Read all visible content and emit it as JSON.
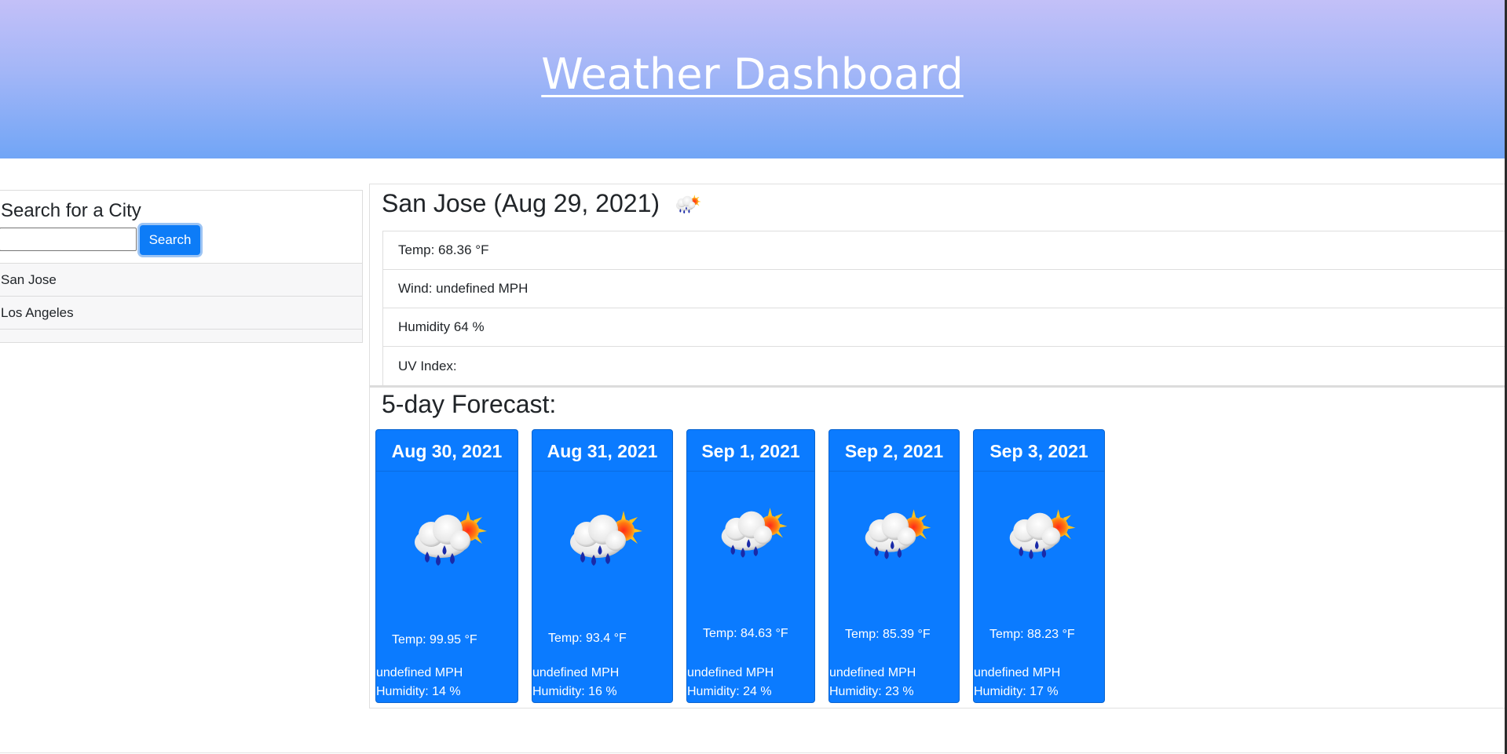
{
  "header": {
    "title": "Weather Dashboard"
  },
  "search": {
    "heading": "Search for a City",
    "input_value": "",
    "input_placeholder": "",
    "button_label": "Search",
    "history": [
      "San Jose",
      "Los Angeles"
    ]
  },
  "current": {
    "title": "San Jose (Aug 29, 2021)",
    "icon": "rain-sun-icon",
    "temp": "Temp: 68.36 °F",
    "wind": "Wind: undefined MPH",
    "humidity": "Humidity 64 %",
    "uv": "UV Index:"
  },
  "forecast": {
    "heading": "5-day Forecast:",
    "days": [
      {
        "date": "Aug 30, 2021",
        "icon": "rain-sun-icon",
        "temp": "Temp: 99.95 °F",
        "wind": "undefined MPH",
        "humidity": "Humidity: 14 %"
      },
      {
        "date": "Aug 31, 2021",
        "icon": "rain-sun-icon",
        "temp": "Temp: 93.4 °F",
        "wind": "undefined MPH",
        "humidity": "Humidity: 16 %"
      },
      {
        "date": "Sep 1, 2021",
        "icon": "rain-sun-icon",
        "temp": "Temp: 84.63 °F",
        "wind": "undefined MPH",
        "humidity": "Humidity: 24 %"
      },
      {
        "date": "Sep 2, 2021",
        "icon": "rain-sun-icon",
        "temp": "Temp: 85.39 °F",
        "wind": "undefined MPH",
        "humidity": "Humidity: 23 %"
      },
      {
        "date": "Sep 3, 2021",
        "icon": "rain-sun-icon",
        "temp": "Temp: 88.23 °F",
        "wind": "undefined MPH",
        "humidity": "Humidity: 17 %"
      }
    ]
  },
  "colors": {
    "header_gradient_top": "#c3c0f8",
    "header_gradient_bottom": "#71a5f6",
    "card_blue": "#0b7bff",
    "button_blue": "#0d7cf7"
  }
}
